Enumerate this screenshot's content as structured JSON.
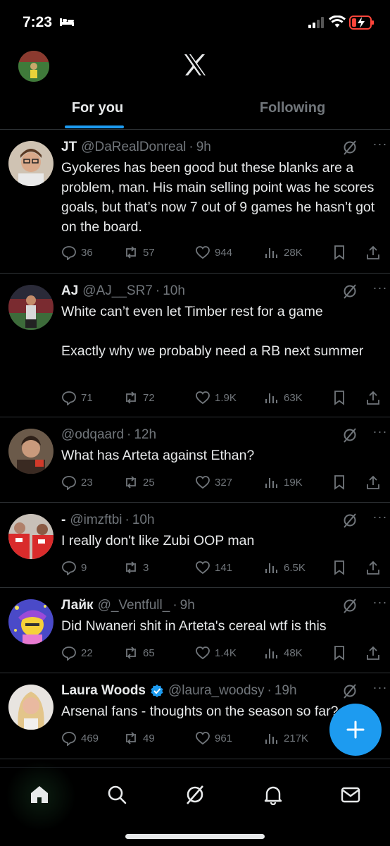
{
  "status_bar": {
    "time": "7:23",
    "icons": [
      "bed-icon",
      "signal-icon",
      "wifi-icon",
      "battery-charging-icon"
    ]
  },
  "header": {
    "logo": "X",
    "tabs": [
      {
        "label": "For you",
        "active": true
      },
      {
        "label": "Following",
        "active": false
      }
    ]
  },
  "colors": {
    "accent": "#1d9bf0",
    "background": "#000000",
    "text": "#e7e9ea",
    "muted": "#71767b",
    "divider": "#2f3336"
  },
  "tweets": [
    {
      "name": "JT",
      "handle": "@DaRealDonreal",
      "time": "9h",
      "verified": false,
      "text": "Gyokeres has been good but these blanks are a problem, man. His main selling point was he scores goals, but that’s now 7 out of 9 games he hasn’t got on the board.",
      "replies": "36",
      "reposts": "57",
      "likes": "944",
      "views": "28K"
    },
    {
      "name": "AJ",
      "handle": "@AJ__SR7",
      "time": "10h",
      "verified": false,
      "text": "White can’t even let Timber rest for a game\n\nExactly why we probably need a RB next summer",
      "replies": "71",
      "reposts": "72",
      "likes": "1.9K",
      "views": "63K"
    },
    {
      "name": "",
      "handle": "@odqaard",
      "time": "12h",
      "verified": false,
      "text": "What has Arteta against Ethan?",
      "replies": "23",
      "reposts": "25",
      "likes": "327",
      "views": "19K"
    },
    {
      "name": "-",
      "handle": "@imzftbi",
      "time": "10h",
      "verified": false,
      "text": "I really don't like Zubi OOP man",
      "replies": "9",
      "reposts": "3",
      "likes": "141",
      "views": "6.5K"
    },
    {
      "name": "Лайк",
      "handle": "@_Ventfull_",
      "time": "9h",
      "verified": false,
      "text": "Did Nwaneri shit in Arteta's cereal wtf is this",
      "replies": "22",
      "reposts": "65",
      "likes": "1.4K",
      "views": "48K"
    },
    {
      "name": "Laura Woods",
      "handle": "@laura_woodsy",
      "time": "19h",
      "verified": true,
      "text": "Arsenal fans - thoughts on the season so far?",
      "replies": "469",
      "reposts": "49",
      "likes": "961",
      "views": "217K"
    }
  ],
  "fab": {
    "icon": "plus-icon"
  },
  "bottom_nav": {
    "items": [
      "home-icon",
      "search-icon",
      "grok-icon",
      "notifications-icon",
      "messages-icon"
    ],
    "active": "home-icon"
  }
}
